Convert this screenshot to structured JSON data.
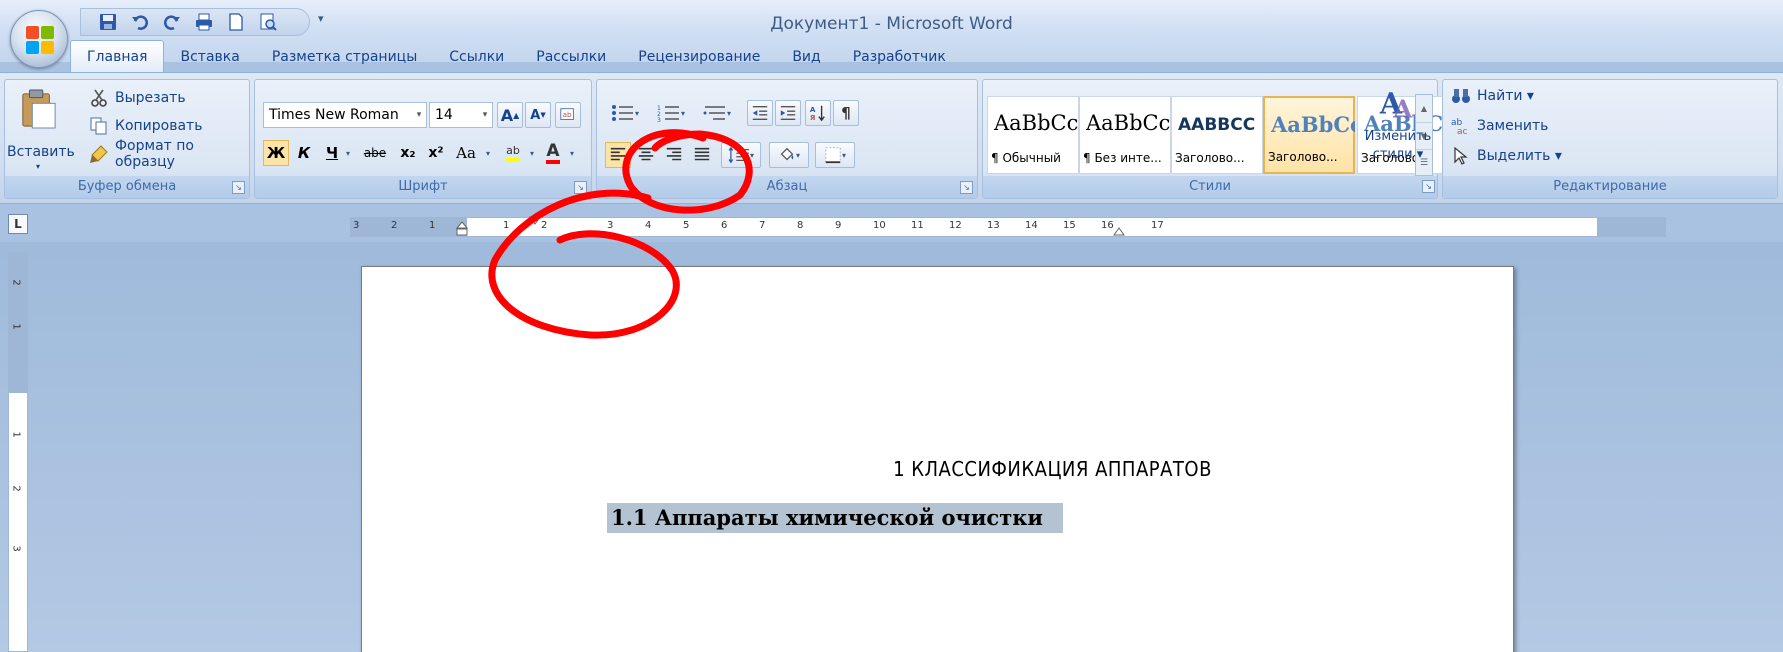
{
  "window": {
    "title": "Документ1 - Microsoft Word"
  },
  "tabs": [
    {
      "label": "Главная",
      "active": true
    },
    {
      "label": "Вставка"
    },
    {
      "label": "Разметка страницы"
    },
    {
      "label": "Ссылки"
    },
    {
      "label": "Рассылки"
    },
    {
      "label": "Рецензирование"
    },
    {
      "label": "Вид"
    },
    {
      "label": "Разработчик"
    }
  ],
  "clipboard": {
    "paste": "Вставить",
    "cut": "Вырезать",
    "copy": "Копировать",
    "format_painter": "Формат по образцу",
    "label": "Буфер обмена"
  },
  "font": {
    "name": "Times New Roman",
    "size": "14",
    "bold": "Ж",
    "italic": "К",
    "underline": "Ч",
    "strike": "abe",
    "subscript": "x₂",
    "superscript": "x²",
    "change_case": "Aa",
    "grow": "A",
    "shrink": "A",
    "font_color": "A",
    "highlight": "ab",
    "label": "Шрифт"
  },
  "paragraph": {
    "pilcrow": "¶",
    "label": "Абзац"
  },
  "styles": {
    "items": [
      {
        "sample": "AaBbCc",
        "name": "¶ Обычный"
      },
      {
        "sample": "AaBbCc",
        "name": "¶ Без инте..."
      },
      {
        "sample": "AABBCC",
        "name": "Заголово..."
      },
      {
        "sample": "AaBbCc",
        "name": "Заголово...",
        "selected": true
      },
      {
        "sample": "AaBbCc",
        "name": "Заголово..."
      }
    ],
    "change_styles_1": "Изменить",
    "change_styles_2": "стили ▾",
    "label": "Стили"
  },
  "editing": {
    "find": "Найти ▾",
    "replace": "Заменить",
    "select": "Выделить ▾",
    "label": "Редактирование"
  },
  "ruler": {
    "corner": "L",
    "labels": [
      "3",
      "2",
      "1",
      "1",
      "2",
      "3",
      "4",
      "5",
      "6",
      "7",
      "8",
      "9",
      "10",
      "11",
      "12",
      "13",
      "14",
      "15",
      "16",
      "17"
    ],
    "vlabels": [
      "2",
      "1",
      "1",
      "2",
      "3"
    ]
  },
  "document": {
    "heading": "1 КЛАССИФИКАЦИЯ АППАРАТОВ",
    "subheading": "1.1 Аппараты химической очистки"
  },
  "colors": {
    "annotation": "#ff0000",
    "selection": "#b3c3d1",
    "ribbon_text": "#15428b"
  }
}
